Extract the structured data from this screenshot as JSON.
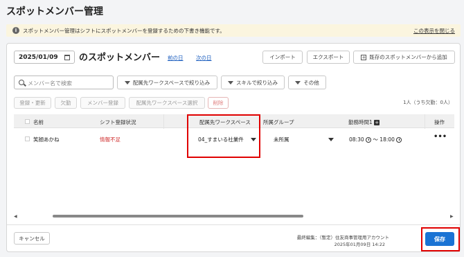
{
  "page_title": "スポットメンバー管理",
  "info_banner": {
    "text": "スポットメンバー管理はシフトにスポットメンバーを登録するための下書き機能です。",
    "hide_link": "この表示を閉じる"
  },
  "date": "2025/01/09",
  "heading": "のスポットメンバー",
  "prev_day": "前の日",
  "next_day": "次の日",
  "toolbar": {
    "import": "インポート",
    "export": "エクスポート",
    "add_existing": "既存のスポットメンバーから追加"
  },
  "search": {
    "placeholder": "メンバー名で検索"
  },
  "filters": {
    "workspace": "配属先ワークスペースで絞り込み",
    "skill": "スキルで絞り込み",
    "other": "その他"
  },
  "actions": {
    "register_update": "登録・更新",
    "absence": "欠勤",
    "member_register": "メンバー登録",
    "workspace_select": "配属先ワークスペース選択",
    "delete": "削除"
  },
  "count_text": "1人（うち欠勤：0人）",
  "table": {
    "headers": {
      "name": "名前",
      "shift_status": "シフト登録状況",
      "workspace": "配属先ワークスペース",
      "group": "所属グループ",
      "work_time": "勤務時間1",
      "ops": "操作"
    },
    "rows": [
      {
        "name": "笑顔あかね",
        "shift_status": "情報不足",
        "workspace": "04_すまいる社業件",
        "group": "未所属",
        "start": "08:30",
        "sep": "〜",
        "end": "18:00",
        "ops": "•••"
      }
    ]
  },
  "footer": {
    "cancel": "キャンセル",
    "last_edit": "最終編集：（暫定）住友商事管理用アカウント",
    "last_edit_time": "2025年01月09日 14:22",
    "save": "保存"
  },
  "colors": {
    "accent": "#1a73d4",
    "warning_text": "#d03030",
    "highlight": "#e00000",
    "banner_bg": "#fbf5df"
  }
}
